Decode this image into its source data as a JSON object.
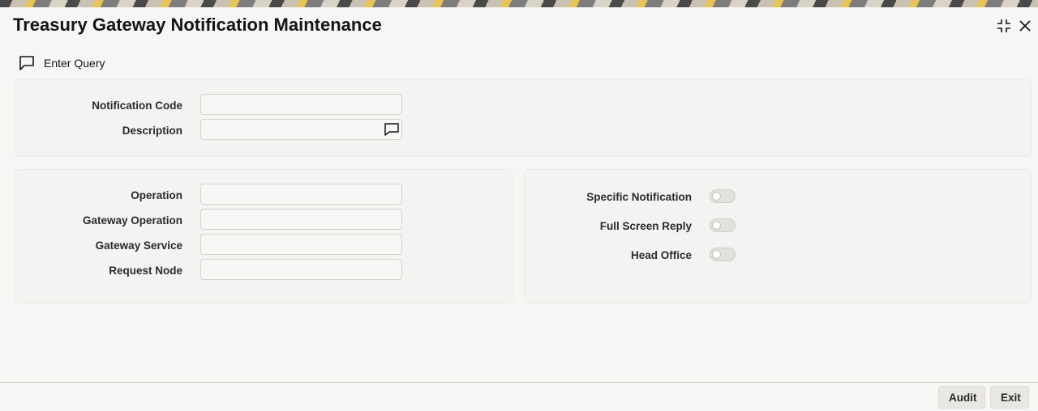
{
  "window": {
    "title": "Treasury Gateway Notification Maintenance",
    "maximize_icon": "maximize-icon",
    "close_icon": "close-icon"
  },
  "toolbar": {
    "enter_query_label": "Enter Query",
    "enter_query_icon": "speech-bubble-icon"
  },
  "header_section": {
    "notification_code": {
      "label": "Notification Code",
      "value": ""
    },
    "description": {
      "label": "Description",
      "value": "",
      "icon": "speech-bubble-icon"
    }
  },
  "left_section": {
    "operation": {
      "label": "Operation",
      "value": ""
    },
    "gateway_operation": {
      "label": "Gateway Operation",
      "value": ""
    },
    "gateway_service": {
      "label": "Gateway Service",
      "value": ""
    },
    "request_node": {
      "label": "Request Node",
      "value": ""
    }
  },
  "right_section": {
    "specific_notification": {
      "label": "Specific Notification",
      "on": false
    },
    "full_screen_reply": {
      "label": "Full Screen Reply",
      "on": false
    },
    "head_office": {
      "label": "Head Office",
      "on": false
    }
  },
  "footer": {
    "audit_label": "Audit",
    "exit_label": "Exit"
  }
}
